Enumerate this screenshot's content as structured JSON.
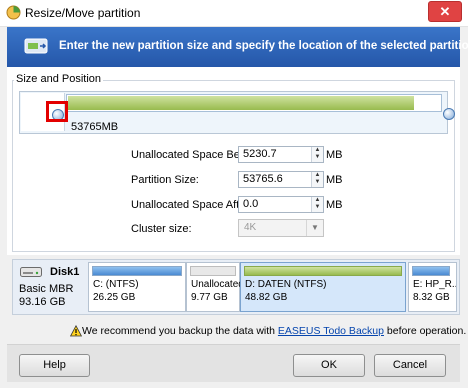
{
  "window": {
    "title": "Resize/Move partition",
    "close": "✕"
  },
  "banner": {
    "text": "Enter the new partition size and specify the location of the selected partition."
  },
  "group": {
    "label": "Size and Position"
  },
  "slider": {
    "size_label": "53765MB",
    "fill_fraction": 0.93
  },
  "fields": {
    "before": {
      "label": "Unallocated Space Before:",
      "value": "5230.7",
      "unit": "MB"
    },
    "size": {
      "label": "Partition Size:",
      "value": "53765.6",
      "unit": "MB"
    },
    "after": {
      "label": "Unallocated Space After:",
      "value": "0.0",
      "unit": "MB"
    },
    "cluster": {
      "label": "Cluster size:",
      "value": "4K"
    }
  },
  "disk": {
    "name": "Disk1",
    "type": "Basic MBR",
    "size": "93.16 GB",
    "partitions": [
      {
        "name": "C: (NTFS)",
        "size": "26.25 GB"
      },
      {
        "name": "Unallocated",
        "size": "9.77 GB"
      },
      {
        "name": "D: DATEN (NTFS)",
        "size": "48.82 GB"
      },
      {
        "name": "E: HP_R...",
        "size": "8.32 GB"
      }
    ]
  },
  "warning": {
    "prefix": "We recommend you backup the data with ",
    "link": "EASEUS Todo Backup",
    "suffix": " before operation."
  },
  "buttons": {
    "help": "Help",
    "ok": "OK",
    "cancel": "Cancel"
  },
  "colors": {
    "banner": "#2f66b8",
    "highlight": "#e30000",
    "partition_fill": "#98bb4e"
  }
}
